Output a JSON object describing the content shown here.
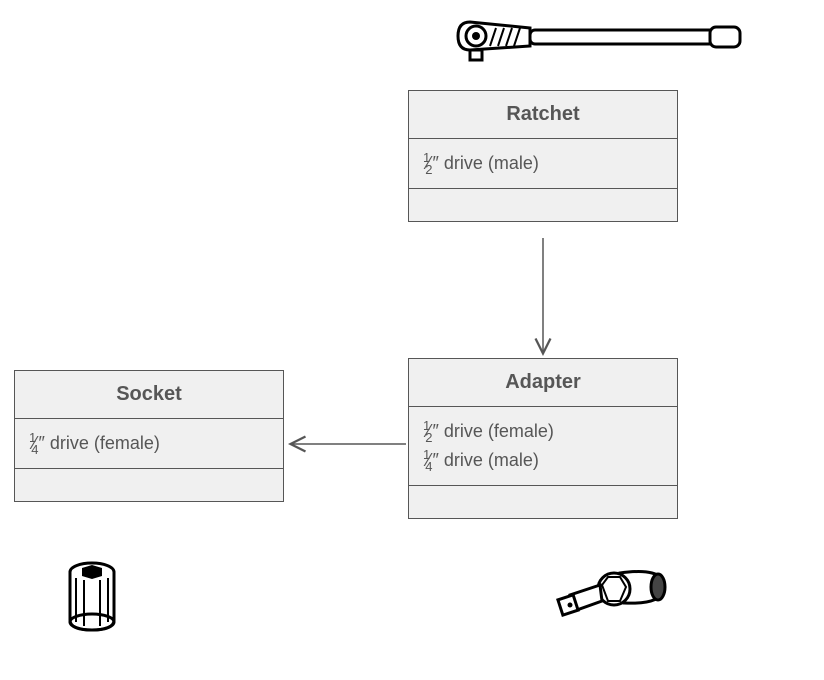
{
  "diagram": {
    "type": "class-diagram",
    "relationships": [
      {
        "from": "Ratchet",
        "to": "Adapter",
        "kind": "association",
        "direction": "down"
      },
      {
        "from": "Adapter",
        "to": "Socket",
        "kind": "association",
        "direction": "left"
      }
    ]
  },
  "classes": {
    "ratchet": {
      "title": "Ratchet",
      "attr1_frac_num": "1",
      "attr1_frac_den": "2",
      "attr1_rest": " drive (male)"
    },
    "adapter": {
      "title": "Adapter",
      "attr1_frac_num": "1",
      "attr1_frac_den": "2",
      "attr1_rest": " drive (female)",
      "attr2_frac_num": "1",
      "attr2_frac_den": "4",
      "attr2_rest": " drive (male)"
    },
    "socket": {
      "title": "Socket",
      "attr1_frac_num": "1",
      "attr1_frac_den": "4",
      "attr1_rest": " drive (female)"
    }
  },
  "icons": {
    "ratchet": "ratchet-tool-icon",
    "socket": "socket-tool-icon",
    "adapter": "adapter-tool-icon"
  }
}
